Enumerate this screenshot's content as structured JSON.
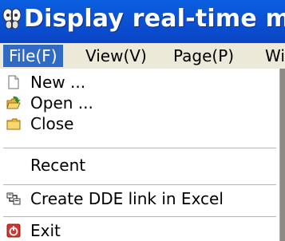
{
  "window": {
    "title": "Display real-time me",
    "icon": "app-butterfly-icon"
  },
  "menubar": {
    "items": [
      {
        "label": "File(F)",
        "active": true
      },
      {
        "label": "View(V)"
      },
      {
        "label": "Page(P)"
      },
      {
        "label": "Wi"
      }
    ]
  },
  "file_menu": {
    "items": [
      {
        "label": "New ...",
        "icon": "new-document-icon"
      },
      {
        "label": "Open ...",
        "icon": "open-folder-icon"
      },
      {
        "label": "Close",
        "icon": "closed-folder-icon"
      },
      {
        "label": "Recent"
      },
      {
        "label": "Create DDE link in Excel",
        "icon": "dde-link-icon"
      },
      {
        "label": "Exit",
        "icon": "exit-icon"
      }
    ]
  },
  "colors": {
    "title_bar": "#0b4fd2",
    "menu_highlight": "#316ac5",
    "menubar_bg": "#ece9d8",
    "exit_icon": "#d2352b"
  }
}
